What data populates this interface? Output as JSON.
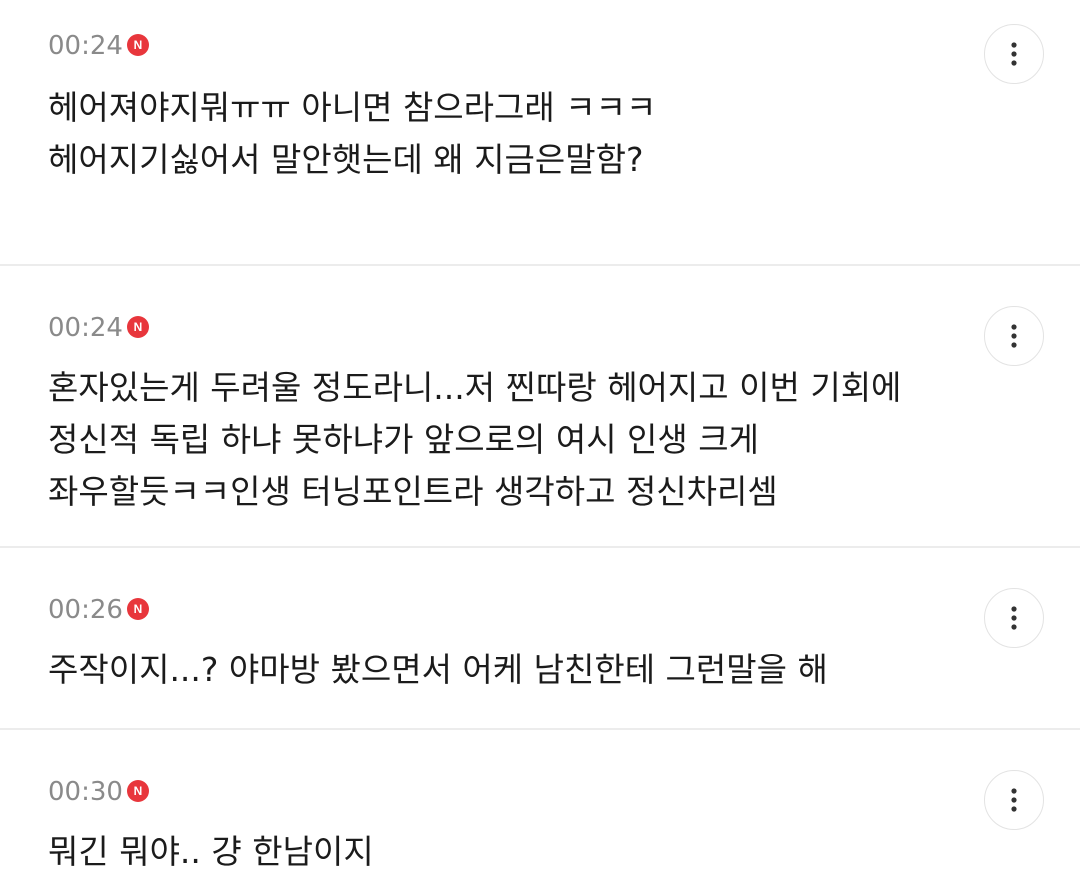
{
  "comments": [
    {
      "time": "00:24",
      "badge": "N",
      "lines": [
        "헤어져야지뭐ㅠㅠ 아니면 참으라그래 ㅋㅋㅋ",
        "헤어지기싫어서 말안햇는데 왜 지금은말함?"
      ]
    },
    {
      "time": "00:24",
      "badge": "N",
      "lines": [
        "혼자있는게 두려울 정도라니...저 찐따랑 헤어지고 이번 기회에",
        "정신적 독립 하냐 못하냐가 앞으로의 여시 인생 크게",
        "좌우할듯ㅋㅋ인생 터닝포인트라 생각하고 정신차리셈"
      ]
    },
    {
      "time": "00:26",
      "badge": "N",
      "lines": [
        "주작이지...? 야마방 봤으면서 어케 남친한테 그런말을 해"
      ]
    },
    {
      "time": "00:30",
      "badge": "N",
      "lines": [
        "뭐긴 뭐야.. 걍 한남이지"
      ]
    }
  ],
  "icons": {
    "more": "more-vertical-icon",
    "new": "new-badge-icon"
  },
  "colors": {
    "badge": "#e8363c",
    "time": "#8a8a8a",
    "text": "#1b1b1b",
    "divider": "#ececec"
  }
}
